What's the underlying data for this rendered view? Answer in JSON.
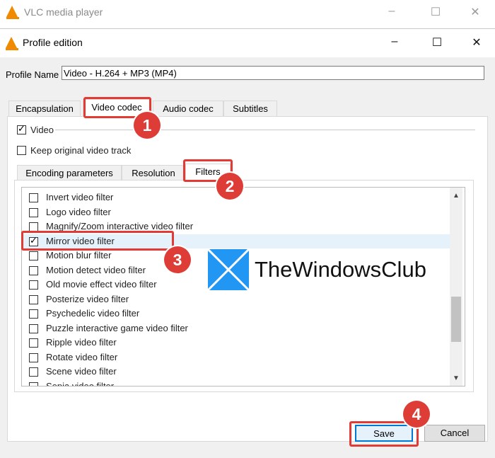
{
  "bg_window": {
    "title": "VLC media player",
    "controls": [
      "–",
      "☐",
      "✕"
    ]
  },
  "dialog": {
    "title": "Profile edition",
    "controls": [
      "–",
      "☐",
      "✕"
    ],
    "profile_name_label": "Profile Name",
    "profile_name_value": "Video - H.264 + MP3 (MP4)",
    "tabs": [
      {
        "label": "Encapsulation",
        "active": false
      },
      {
        "label": "Video codec",
        "active": true
      },
      {
        "label": "Audio codec",
        "active": false
      },
      {
        "label": "Subtitles",
        "active": false
      }
    ],
    "video_checkbox_label": "Video",
    "keep_original_label": "Keep original video track",
    "subtabs": [
      {
        "label": "Encoding parameters",
        "active": false
      },
      {
        "label": "Resolution",
        "active": false
      },
      {
        "label": "Filters",
        "active": true
      }
    ],
    "filters": [
      {
        "label": "Invert video filter",
        "checked": false
      },
      {
        "label": "Logo video filter",
        "checked": false
      },
      {
        "label": "Magnify/Zoom interactive video filter",
        "checked": false
      },
      {
        "label": "Mirror video filter",
        "checked": true
      },
      {
        "label": "Motion blur filter",
        "checked": false
      },
      {
        "label": "Motion detect video filter",
        "checked": false
      },
      {
        "label": "Old movie effect video filter",
        "checked": false
      },
      {
        "label": "Posterize video filter",
        "checked": false
      },
      {
        "label": "Psychedelic video filter",
        "checked": false
      },
      {
        "label": "Puzzle interactive game video filter",
        "checked": false
      },
      {
        "label": "Ripple video filter",
        "checked": false
      },
      {
        "label": "Rotate video filter",
        "checked": false
      },
      {
        "label": "Scene video filter",
        "checked": false
      },
      {
        "label": "Sepia video filter",
        "checked": false
      }
    ],
    "save_label": "Save",
    "cancel_label": "Cancel"
  },
  "annotations": {
    "badges": [
      "1",
      "2",
      "3",
      "4"
    ]
  },
  "watermark": {
    "text": "TheWindowsClub"
  },
  "colors": {
    "annotation_red": "#e23a35",
    "accent_blue": "#0078d7",
    "vlc_orange": "#f08a00"
  }
}
